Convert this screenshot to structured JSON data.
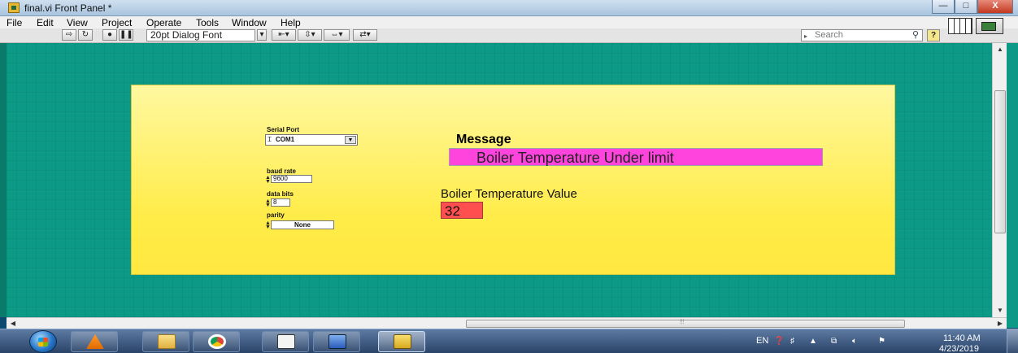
{
  "window": {
    "title": "final.vi Front Panel *",
    "minimize": "—",
    "maximize": "□",
    "close": "X"
  },
  "menu": [
    "File",
    "Edit",
    "View",
    "Project",
    "Operate",
    "Tools",
    "Window",
    "Help"
  ],
  "toolbar": {
    "font": "20pt Dialog Font",
    "search_placeholder": "Search",
    "help": "?"
  },
  "controls": {
    "serial_port": {
      "label": "Serial Port",
      "value": "COM1"
    },
    "baud_rate": {
      "label": "baud rate",
      "value": "9600"
    },
    "data_bits": {
      "label": "data bits",
      "value": "8"
    },
    "parity": {
      "label": "parity",
      "value": "None"
    }
  },
  "indicators": {
    "message": {
      "label": "Message",
      "value": "Boiler Temperature Under limit",
      "color": "#ff44dd"
    },
    "temperature": {
      "label": "Boiler Temperature Value",
      "value": "32",
      "color": "#ff4f4f"
    }
  },
  "taskbar": {
    "language": "EN",
    "time": "11:40 AM",
    "date": "4/23/2019"
  },
  "colors": {
    "panel": "#0c9a86",
    "decoration": "#ffec48"
  }
}
